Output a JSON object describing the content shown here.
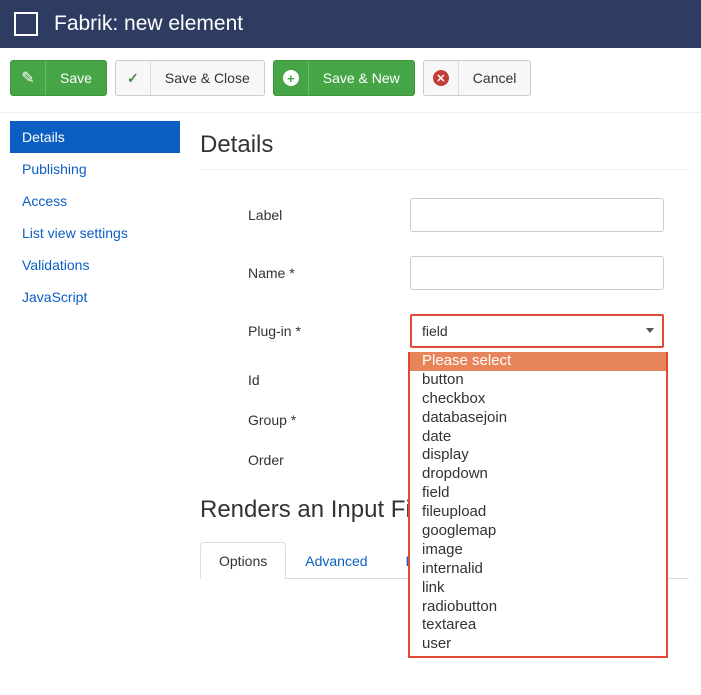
{
  "header": {
    "title": "Fabrik: new element"
  },
  "toolbar": {
    "save": "Save",
    "save_close": "Save & Close",
    "save_new": "Save & New",
    "cancel": "Cancel"
  },
  "sidebar": {
    "items": [
      {
        "label": "Details",
        "active": true
      },
      {
        "label": "Publishing",
        "active": false
      },
      {
        "label": "Access",
        "active": false
      },
      {
        "label": "List view settings",
        "active": false
      },
      {
        "label": "Validations",
        "active": false
      },
      {
        "label": "JavaScript",
        "active": false
      }
    ]
  },
  "details": {
    "heading": "Details",
    "fields": {
      "label": "Label",
      "name": "Name *",
      "plugin": "Plug-in *",
      "id": "Id",
      "group": "Group *",
      "order": "Order"
    },
    "plugin_value": "field",
    "plugin_options": [
      "Please select",
      "button",
      "checkbox",
      "databasejoin",
      "date",
      "display",
      "dropdown",
      "field",
      "fileupload",
      "googlemap",
      "image",
      "internalid",
      "link",
      "radiobutton",
      "textarea",
      "user"
    ]
  },
  "renders": {
    "heading_partial": "Renders an Input Fi"
  },
  "tabs": {
    "items": [
      {
        "label": "Options",
        "active": true
      },
      {
        "label": "Advanced",
        "active": false
      },
      {
        "label": "For",
        "active": false
      }
    ]
  }
}
